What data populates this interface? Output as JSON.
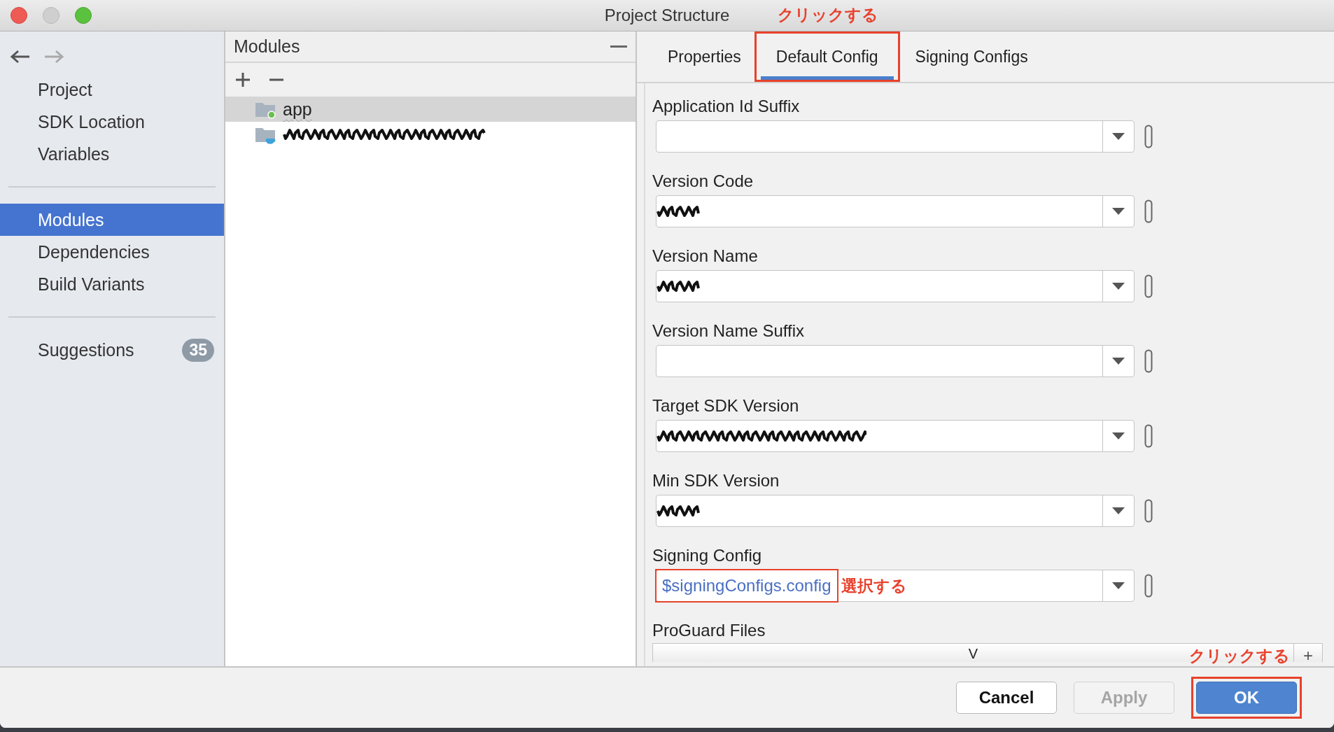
{
  "window": {
    "title": "Project Structure"
  },
  "sidebar": {
    "sections": [
      {
        "items": [
          {
            "label": "Project",
            "selected": false
          },
          {
            "label": "SDK Location",
            "selected": false
          },
          {
            "label": "Variables",
            "selected": false
          }
        ]
      },
      {
        "items": [
          {
            "label": "Modules",
            "selected": true
          },
          {
            "label": "Dependencies",
            "selected": false
          },
          {
            "label": "Build Variants",
            "selected": false
          }
        ]
      },
      {
        "items": [
          {
            "label": "Suggestions",
            "selected": false,
            "badge": "35"
          }
        ]
      }
    ]
  },
  "modules": {
    "title": "Modules",
    "items": [
      {
        "kind": "app",
        "label": "app",
        "selected": true
      },
      {
        "kind": "library",
        "redacted": true,
        "selected": false
      }
    ]
  },
  "tabs": [
    {
      "label": "Properties",
      "selected": false
    },
    {
      "label": "Default Config",
      "selected": true,
      "annotation": "クリックする"
    },
    {
      "label": "Signing Configs",
      "selected": false
    }
  ],
  "fields": [
    {
      "label": "Application Id Suffix"
    },
    {
      "label": "Version Code",
      "redacted": true
    },
    {
      "label": "Version Name",
      "redacted": true
    },
    {
      "label": "Version Name Suffix"
    },
    {
      "label": "Target SDK Version",
      "redacted": true
    },
    {
      "label": "Min SDK Version",
      "redacted": true
    },
    {
      "label": "Signing Config",
      "value": "$signingConfigs.config",
      "annotation": "選択する"
    }
  ],
  "proguard": {
    "label": "ProGuard Files",
    "column_1": "V",
    "add": "+"
  },
  "buttons": [
    {
      "label": "Cancel",
      "kind": "default",
      "disabled": false
    },
    {
      "label": "Apply",
      "kind": "default",
      "disabled": true
    },
    {
      "label": "OK",
      "kind": "primary",
      "disabled": false,
      "annotation": "クリックする"
    }
  ]
}
